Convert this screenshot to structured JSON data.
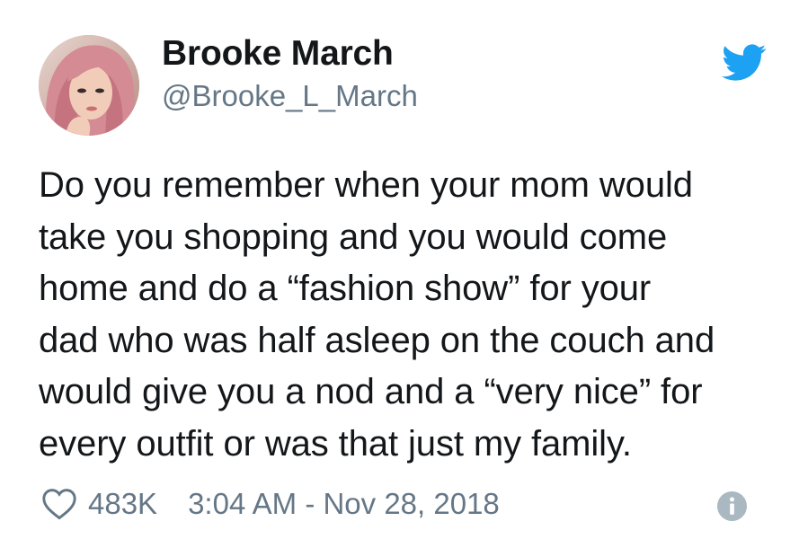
{
  "author": {
    "display_name": "Brooke March",
    "handle": "@Brooke_L_March"
  },
  "tweet": {
    "lines": [
      "Do you remember when your mom would",
      "take you shopping and you would come",
      "home and do a “fashion show” for your",
      "dad who was half asleep on the couch and",
      "would give you a nod and a “very nice” for",
      "every outfit or was that just my family."
    ]
  },
  "footer": {
    "likes": "483K",
    "timestamp": "3:04 AM - Nov 28, 2018"
  },
  "icons": {
    "brand": "twitter-bird-icon",
    "like": "heart-icon",
    "info": "info-icon"
  },
  "colors": {
    "twitter_blue": "#1da1f2",
    "text_primary": "#14171a",
    "text_secondary": "#657786",
    "info_gray": "#aab8c2"
  }
}
